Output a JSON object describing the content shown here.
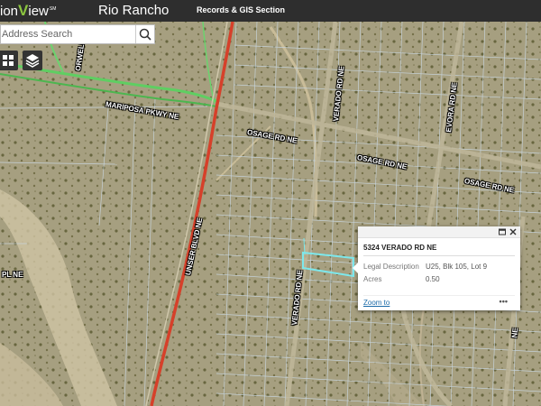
{
  "header": {
    "brand_prefix": "ion",
    "brand_v": "V",
    "brand_suffix": "iew",
    "brand_mark": "SM",
    "city": "Rio Rancho",
    "section": "Records & GIS Section"
  },
  "search": {
    "placeholder": "Address Search",
    "icon": "search-icon"
  },
  "controls": {
    "basemap_icon": "grid-icon",
    "layers_icon": "layers-icon"
  },
  "popup": {
    "title": "5324 VERADO RD NE",
    "fields": [
      {
        "label": "Legal Description",
        "value": "U25, Blk 105, Lot 9"
      },
      {
        "label": "Acres",
        "value": "0.50"
      }
    ],
    "zoom_link": "Zoom to",
    "more": "•••",
    "icons": [
      "maximize-icon",
      "close-icon"
    ]
  },
  "map": {
    "roads": [
      "ORWELL RD",
      "MARIPOSA PKWY NE",
      "OSAGE RD NE",
      "OSAGE RD NE",
      "OSAGE RD NE",
      "VERADO RD NE",
      "VERADO RD NE",
      "EVORA RD NE",
      "UNSER BLVD NE",
      "PL NE",
      "NE"
    ],
    "colors": {
      "highway": "#d6402a",
      "highlight": "#7de8ec",
      "parcel": "#c7d4dc",
      "green_road": "#5fce62"
    }
  }
}
